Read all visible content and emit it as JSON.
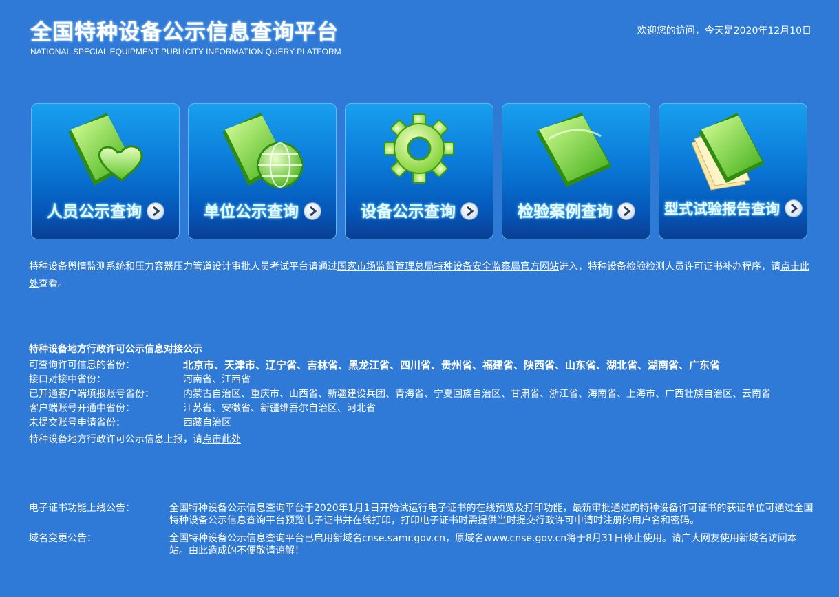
{
  "header": {
    "title": "全国特种设备公示信息查询平台",
    "subtitle": "NATIONAL SPECIAL EQUIPMENT PUBLICITY INFORMATION QUERY PLATFORM",
    "welcome": "欢迎您的访问，今天是2020年12月10日"
  },
  "cards": [
    {
      "label": "人员公示查询",
      "icon": "folder-heart-icon"
    },
    {
      "label": "单位公示查询",
      "icon": "folder-globe-icon"
    },
    {
      "label": "设备公示查询",
      "icon": "gear-icon"
    },
    {
      "label": "检验案例查询",
      "icon": "folder-icon"
    },
    {
      "label": "型式试验报告查询",
      "icon": "documents-icon"
    }
  ],
  "notice": {
    "text_before": "特种设备舆情监测系统和压力容器压力管道设计审批人员考试平台请通过",
    "link1": "国家市场监督管理总局特种设备安全监察局官方网站",
    "text_middle": "进入，特种设备检验检测人员许可证书补办程序，请",
    "link2": "点击此处",
    "text_after": "查看。"
  },
  "province": {
    "title": "特种设备地方行政许可公示信息对接公示",
    "rows": [
      {
        "label": "可查询许可信息的省份：",
        "value": "北京市、天津市、辽宁省、吉林省、黑龙江省、四川省、贵州省、福建省、陕西省、山东省、湖北省、湖南省、广东省"
      },
      {
        "label": "接口对接中省份：",
        "value": "河南省、江西省"
      },
      {
        "label": "已开通客户端填报账号省份：",
        "value": "内蒙古自治区、重庆市、山西省、新疆建设兵团、青海省、宁夏回族自治区、甘肃省、浙江省、海南省、上海市、广西壮族自治区、云南省"
      },
      {
        "label": "客户端账号开通中省份：",
        "value": "江苏省、安徽省、新疆维吾尔自治区、河北省"
      },
      {
        "label": "未提交账号申请省份：",
        "value": "西藏自治区"
      }
    ],
    "report_text": "特种设备地方行政许可公示信息上报，请",
    "report_link": "点击此处"
  },
  "announcements": [
    {
      "label": "电子证书功能上线公告：",
      "text": "全国特种设备公示信息查询平台于2020年1月1日开始试运行电子证书的在线预览及打印功能，最新审批通过的特种设备许可证书的获证单位可通过全国特种设备公示信息查询平台预览电子证书并在线打印，打印电子证书时需提供当时提交行政许可申请时注册的用户名和密码。"
    },
    {
      "label": "域名变更公告：",
      "text": "全国特种设备公示信息查询平台已启用新域名cnse.samr.gov.cn，原域名www.cnse.gov.cn将于8月31日停止使用。请广大网友使用新域名访问本站。由此造成的不便敬请谅解！"
    }
  ]
}
